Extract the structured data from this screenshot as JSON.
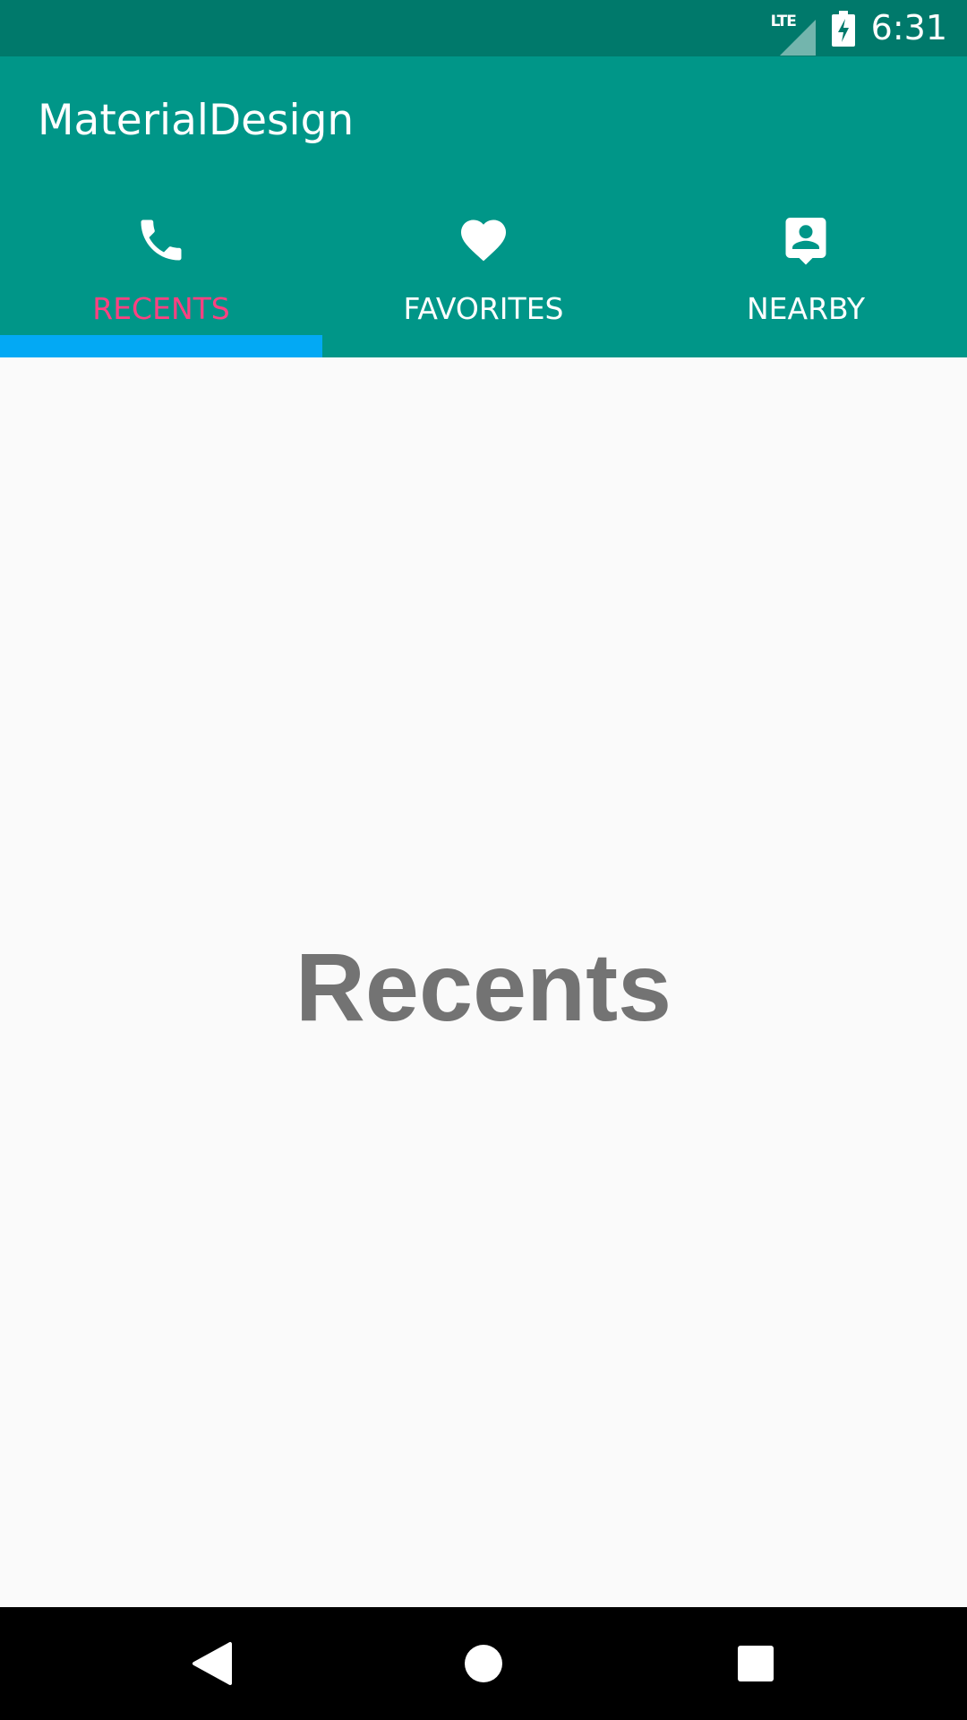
{
  "status_bar": {
    "network": "LTE",
    "time": "6:31",
    "icons": [
      "signal-icon",
      "battery-charging-icon"
    ]
  },
  "app_bar": {
    "title": "MaterialDesign"
  },
  "tabs": [
    {
      "label": "RECENTS",
      "icon": "phone-icon",
      "selected": true
    },
    {
      "label": "FAVORITES",
      "icon": "heart-icon",
      "selected": false
    },
    {
      "label": "NEARBY",
      "icon": "contact-pin-icon",
      "selected": false
    }
  ],
  "content": {
    "title": "Recents"
  },
  "nav_bar": {
    "icons": [
      "back-icon",
      "home-icon",
      "recents-icon"
    ]
  },
  "colors": {
    "status_bar": "#00796B",
    "primary": "#009688",
    "accent": "#FF4081",
    "indicator": "#03A9F4",
    "background": "#FAFAFA",
    "content_text": "#737373"
  }
}
